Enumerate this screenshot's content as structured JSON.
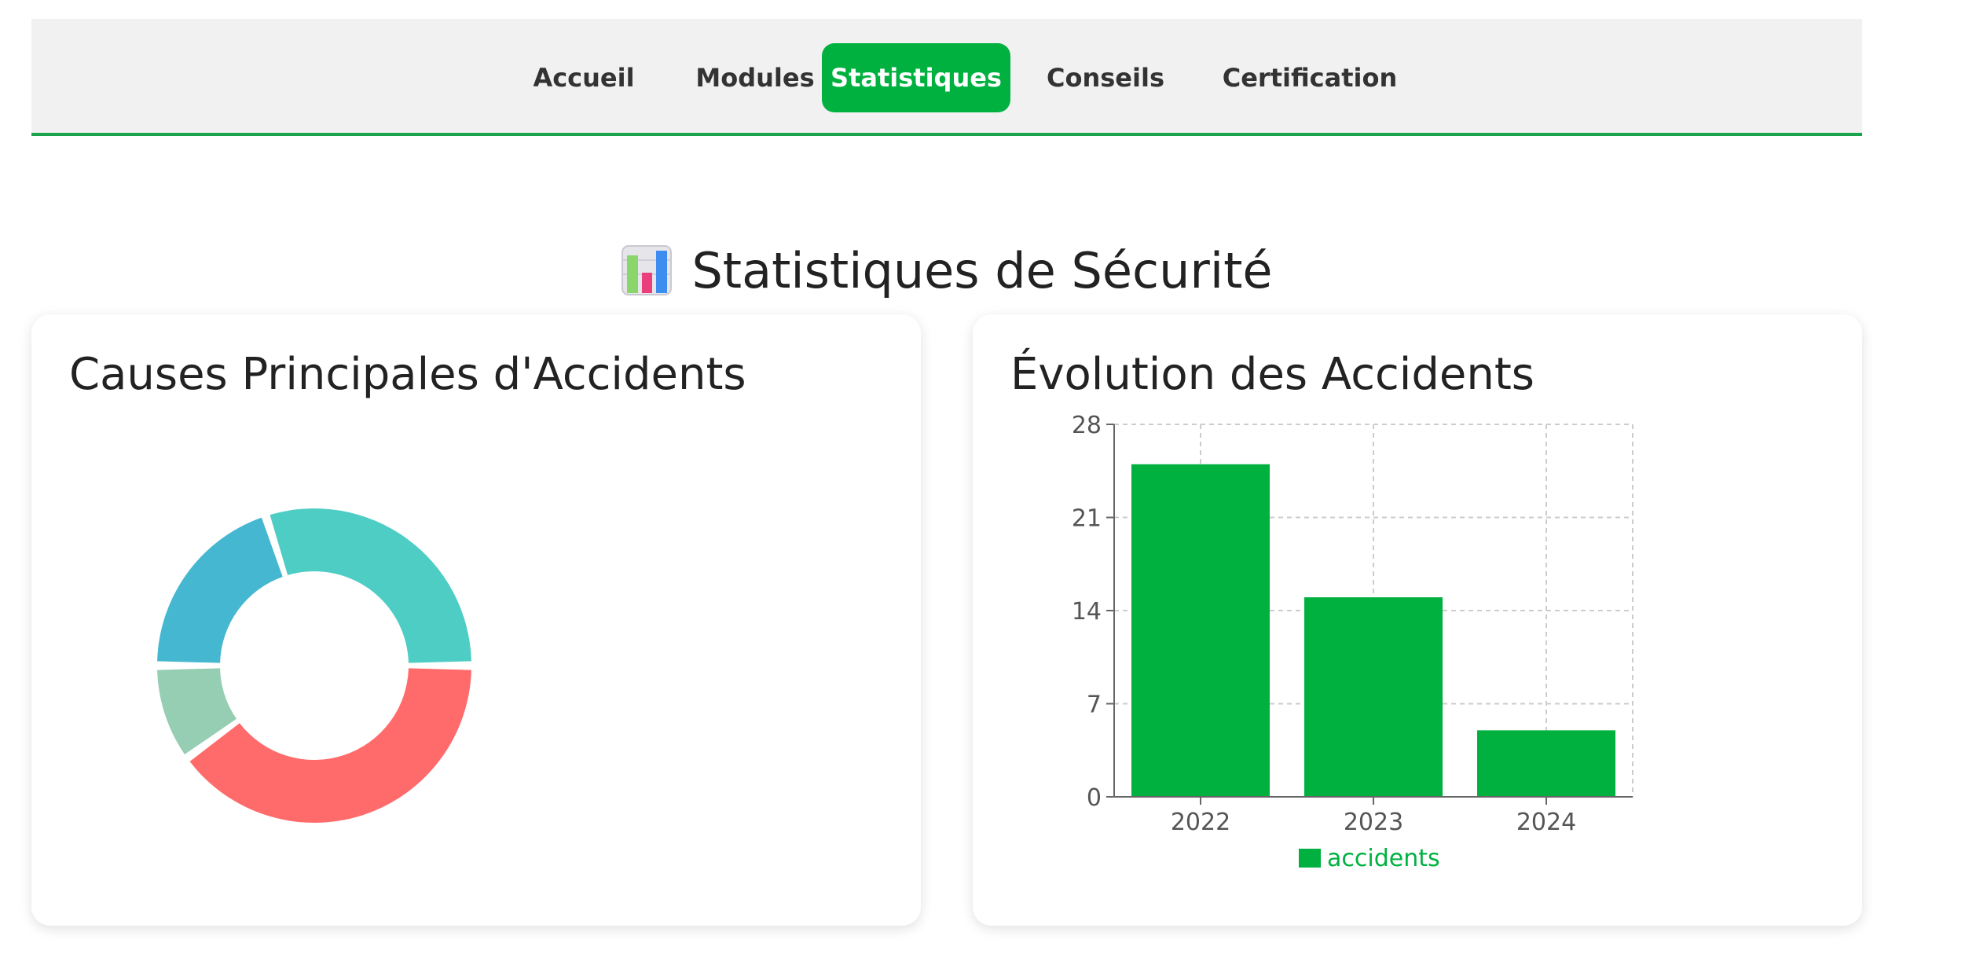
{
  "nav": {
    "items": [
      {
        "label": "Accueil",
        "active": false
      },
      {
        "label": "Modules",
        "active": false
      },
      {
        "label": "Statistiques",
        "active": true
      },
      {
        "label": "Conseils",
        "active": false
      },
      {
        "label": "Certification",
        "active": false
      }
    ],
    "active_color": "#00b140",
    "border_color": "#1aa34a"
  },
  "page": {
    "title": "Statistiques de Sécurité",
    "title_icon": "bar-chart-emoji-icon"
  },
  "cards": {
    "causes": {
      "title": "Causes Principales d'Accidents"
    },
    "evolution": {
      "title": "Évolution des Accidents"
    }
  },
  "chart_data": [
    {
      "type": "pie",
      "title": "Causes Principales d'Accidents",
      "donut": true,
      "values": [
        40,
        10,
        20,
        30
      ],
      "colors": [
        "#ff6b6b",
        "#96ceb4",
        "#45b7d1",
        "#4ecdc4"
      ],
      "legend": "none"
    },
    {
      "type": "bar",
      "title": "Évolution des Accidents",
      "categories": [
        "2022",
        "2023",
        "2024"
      ],
      "series": [
        {
          "name": "accidents",
          "values": [
            25,
            15,
            5
          ],
          "color": "#00b140"
        }
      ],
      "ylim": [
        0,
        28
      ],
      "yticks": [
        "0",
        "7",
        "14",
        "21",
        "28"
      ],
      "grid": true,
      "legend_position": "bottom"
    }
  ]
}
